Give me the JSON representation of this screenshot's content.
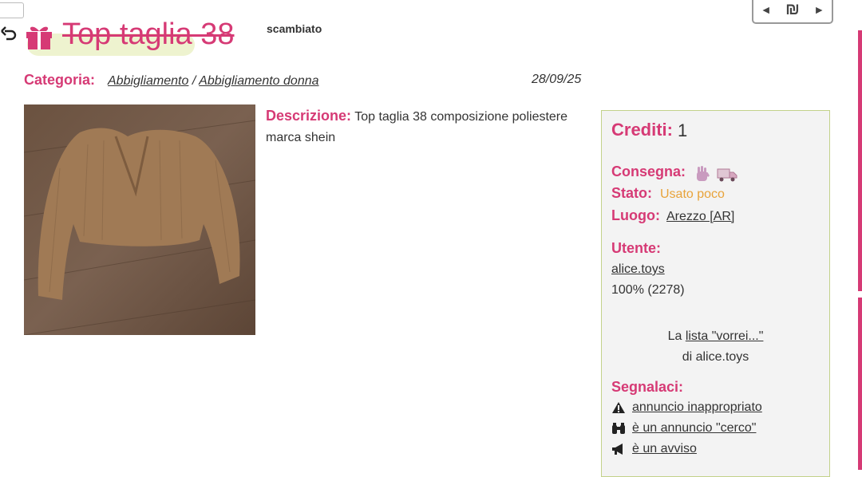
{
  "header": {
    "title": "Top taglia 38",
    "status": "scambiato",
    "nav": {
      "prev": "◄",
      "currency": "₪",
      "next": "►"
    }
  },
  "meta": {
    "categoria_label": "Categoria:",
    "category": "Abbigliamento",
    "separator": "/",
    "subcategory": "Abbigliamento donna",
    "date": "28/09/25"
  },
  "description": {
    "label": "Descrizione:",
    "text": "Top taglia 38 composizione poliestere marca shein"
  },
  "panel": {
    "crediti_label": "Crediti:",
    "crediti_value": "1",
    "consegna_label": "Consegna:",
    "stato_label": "Stato:",
    "stato_value": "Usato poco",
    "luogo_label": "Luogo:",
    "luogo_value": "Arezzo [AR]",
    "utente_label": "Utente:",
    "utente_value": "alice.toys",
    "feedback": "100% (2278)",
    "wishlist_prefix": "La",
    "wishlist_link": "lista \"vorrei...\"",
    "wishlist_suffix": "di alice.toys",
    "segnalaci_label": "Segnalaci:",
    "reports": [
      {
        "label": "annuncio inappropriato",
        "icon": "warning-icon"
      },
      {
        "label": "è un annuncio \"cerco\"",
        "icon": "binoculars-icon"
      },
      {
        "label": "è un avviso",
        "icon": "megaphone-icon"
      }
    ]
  },
  "colors": {
    "accent": "#d63a75",
    "status_used": "#e8a33a",
    "panel_border": "#c3d28a"
  }
}
